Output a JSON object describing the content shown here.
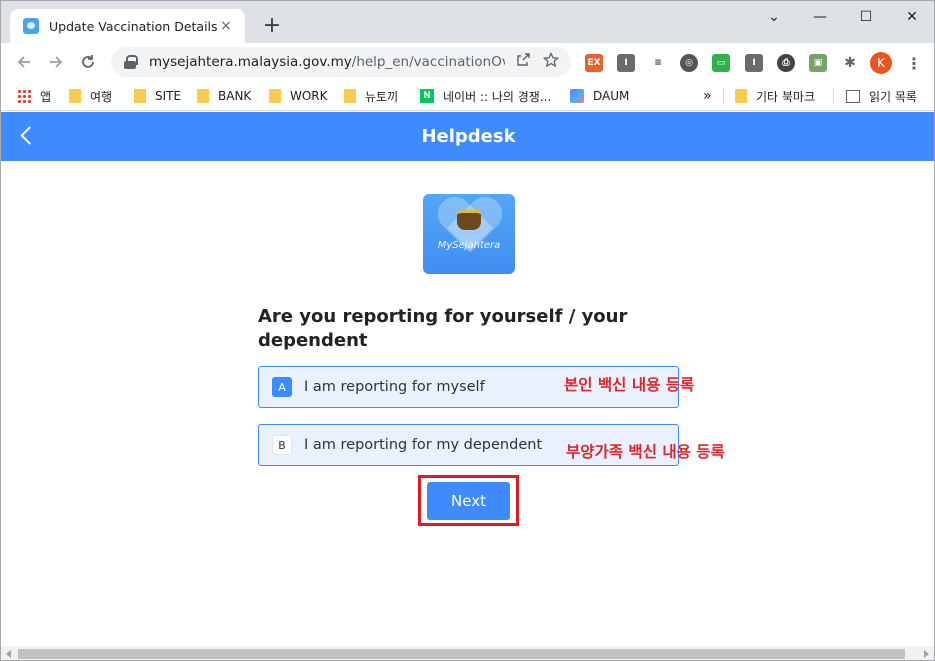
{
  "browser": {
    "tab": {
      "title": "Update Vaccination Details",
      "close_icon": "×"
    },
    "new_tab_icon": "+",
    "window_controls": {
      "minimize": "⌄",
      "min": "—",
      "max": "☐",
      "close": "✕"
    },
    "url": {
      "domain": "mysejahtera.malaysia.gov.my",
      "path": "/help_en/vaccinationOver..."
    },
    "profile_initial": "K",
    "bookmarks": [
      {
        "label": "앱",
        "icon": "apps-grid-icon"
      },
      {
        "label": "여행",
        "icon": "folder-icon"
      },
      {
        "label": "SITE",
        "icon": "folder-icon"
      },
      {
        "label": "BANK",
        "icon": "folder-icon"
      },
      {
        "label": "WORK",
        "icon": "folder-icon"
      },
      {
        "label": "뉴토끼",
        "icon": "folder-icon"
      },
      {
        "label": "네이버 :: 나의 경쟁...",
        "icon": "naver-icon"
      },
      {
        "label": "DAUM",
        "icon": "daum-icon"
      }
    ],
    "bookmarks_overflow": "»",
    "other_bookmarks": "기타 북마크",
    "reading_list": "읽기 목록"
  },
  "app": {
    "header_title": "Helpdesk",
    "logo_text": "MySejahtera",
    "question": "Are you reporting for yourself / your dependent",
    "options": [
      {
        "key": "A",
        "label": "I am reporting for myself",
        "selected": true
      },
      {
        "key": "B",
        "label": "I am reporting for my dependent",
        "selected": false
      }
    ],
    "next_label": "Next"
  },
  "annotations": {
    "option_a_note": "본인 백신 내용 등록",
    "option_b_note": "부양가족 백신 내용 등록"
  },
  "colors": {
    "primary": "#3d8bfd",
    "option_bg": "#e9f1fe",
    "annotation_red": "#e0252b"
  }
}
